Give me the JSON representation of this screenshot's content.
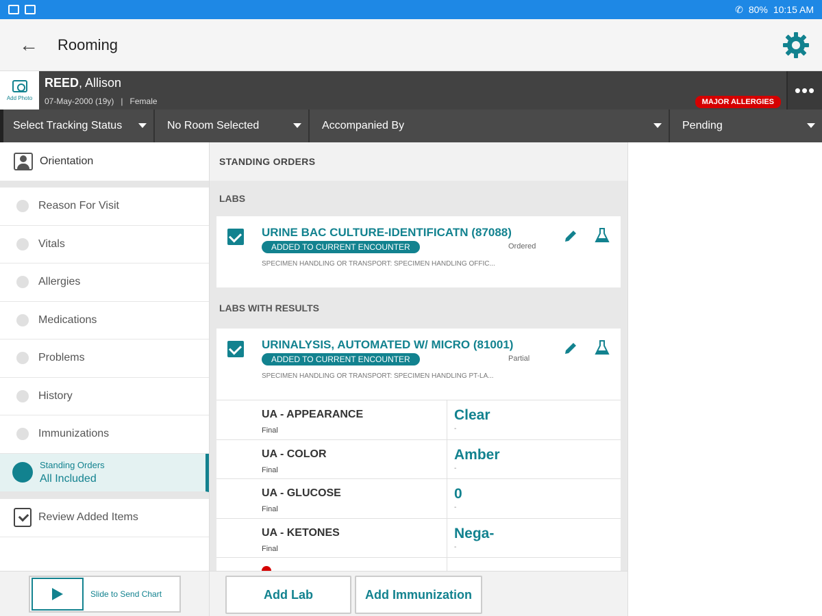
{
  "status": {
    "battery": "80%",
    "time": "10:15 AM"
  },
  "appbar": {
    "title": "Rooming"
  },
  "patient": {
    "last": "REED",
    "first": ", Allison",
    "dob": "07-May-2000 (19y)",
    "sex": "Female",
    "add_photo": "Add Photo",
    "allergy_badge": "MAJOR ALLERGIES"
  },
  "dropdowns": {
    "tracking": "Select Tracking Status",
    "room": "No Room Selected",
    "accompanied": "Accompanied By",
    "status": "Pending"
  },
  "nav": {
    "orientation": "Orientation",
    "items": [
      "Reason For Visit",
      "Vitals",
      "Allergies",
      "Medications",
      "Problems",
      "History",
      "Immunizations"
    ],
    "active": {
      "label1": "Standing Orders",
      "label2": "All Included"
    },
    "review": "Review Added Items"
  },
  "main": {
    "section": "STANDING ORDERS",
    "labs_header": "LABS",
    "lab1": {
      "title": "URINE BAC CULTURE-IDENTIFICATN (87088)",
      "badge": "ADDED TO CURRENT ENCOUNTER",
      "status": "Ordered",
      "desc": "SPECIMEN HANDLING OR TRANSPORT: SPECIMEN HANDLING OFFIC..."
    },
    "labs_results_header": "LABS WITH RESULTS",
    "lab2": {
      "title": "URINALYSIS, AUTOMATED W/ MICRO (81001)",
      "badge": "ADDED TO CURRENT ENCOUNTER",
      "status": "Partial",
      "desc": "SPECIMEN HANDLING OR TRANSPORT: SPECIMEN HANDLING PT-LA..."
    },
    "results": [
      {
        "name": "UA - APPEARANCE",
        "status": "Final",
        "value": "Clear",
        "sub": "-"
      },
      {
        "name": "UA - COLOR",
        "status": "Final",
        "value": "Amber",
        "sub": "-"
      },
      {
        "name": "UA - GLUCOSE",
        "status": "Final",
        "value": "0",
        "sub": "-"
      },
      {
        "name": "UA - KETONES",
        "status": "Final",
        "value": "Nega-",
        "sub": "-"
      }
    ]
  },
  "bottom": {
    "slide": "Slide to Send Chart",
    "add_lab": "Add Lab",
    "add_immunization": "Add Immunization"
  },
  "colors": {
    "accent": "#12828f",
    "statusbar": "#1e88e5",
    "allergy": "#d50000"
  }
}
